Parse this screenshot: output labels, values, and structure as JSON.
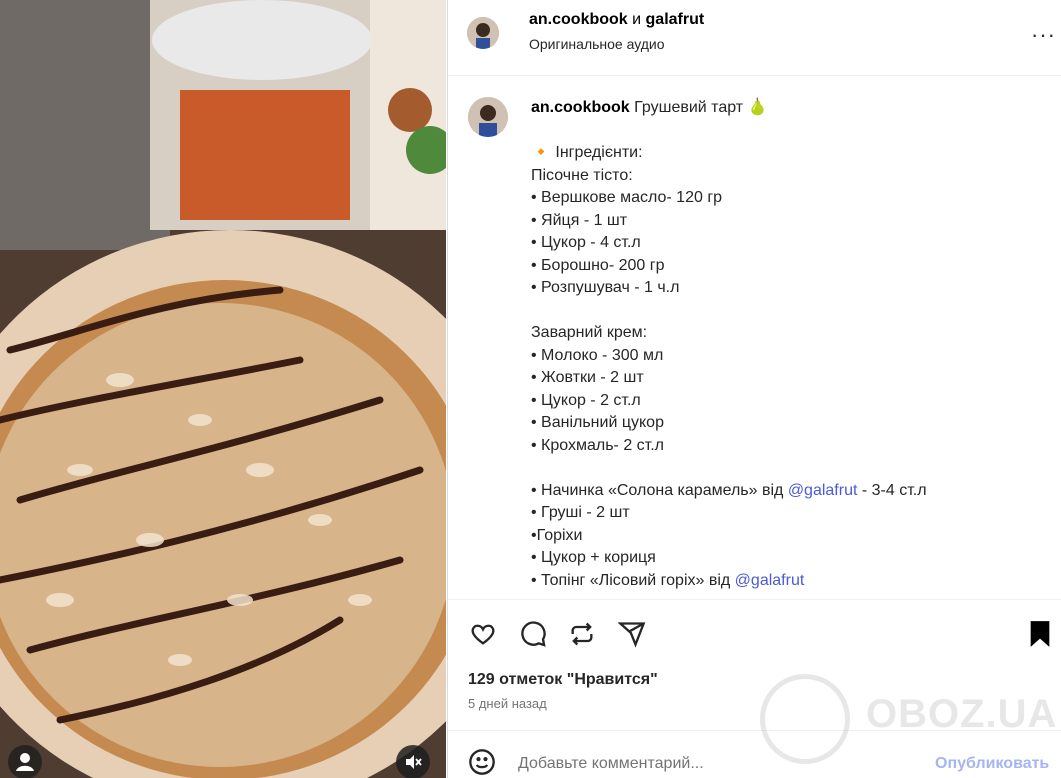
{
  "header": {
    "user1": "an.cookbook",
    "and": "и",
    "user2": "galafrut",
    "audio": "Оригинальное аудио",
    "more": "···"
  },
  "caption": {
    "author": "an.cookbook",
    "title": " Грушевий тарт 🍐",
    "lines": [
      "",
      "🔸 Інгредієнти:",
      "Пісочне тісто:",
      "• Вершкове масло- 120 гр",
      "• Яйця - 1 шт",
      "• Цукор - 4 ст.л",
      "• Борошно- 200 гр",
      "• Розпушувач - 1 ч.л",
      "",
      "Заварний крем:",
      "• Молоко - 300 мл",
      "• Жовтки - 2 шт",
      "• Цукор - 2 ст.л",
      "• Ванільний цукор",
      "• Крохмаль- 2 ст.л",
      ""
    ],
    "filling_prefix": "• Начинка «Солона карамель» від ",
    "filling_mention": "@galafrut",
    "filling_suffix": " - 3-4 ст.л",
    "after_filling": [
      "• Груші - 2 шт",
      "•Горіхи",
      "• Цукор + кориця"
    ],
    "topping_prefix": "• Топінг «Лісовий горіх» від ",
    "topping_mention": "@galafrut"
  },
  "likes": "129 отметок \"Нравится\"",
  "ago": "5 дней назад",
  "comment": {
    "placeholder": "Добавьте комментарий...",
    "post": "Опубликовать"
  },
  "watermark": "OBOZ.UA",
  "icons": [
    "like-icon",
    "comment-icon",
    "repost-icon",
    "share-icon",
    "save-icon",
    "emoji-icon",
    "mute-icon",
    "user-tag-icon"
  ],
  "colors": {
    "mention": "#4a5ad8",
    "post_button": "#a5b4f5",
    "muted_text": "#737373"
  }
}
